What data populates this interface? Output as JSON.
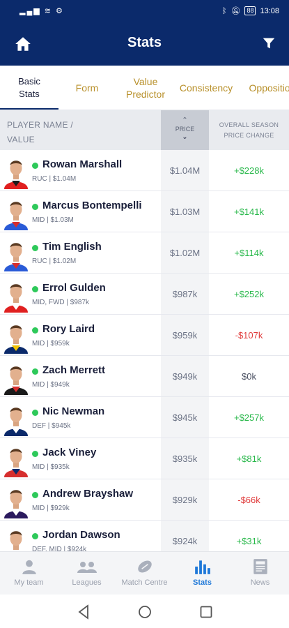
{
  "status_bar": {
    "time": "13:08",
    "battery": "88",
    "left_icons": "signal-wifi-icons"
  },
  "header": {
    "title": "Stats"
  },
  "tabs": [
    {
      "label": "Basic\nStats",
      "active": true
    },
    {
      "label": "Form"
    },
    {
      "label": "Value\nPredictor"
    },
    {
      "label": "Consistency"
    },
    {
      "label": "Opposition"
    }
  ],
  "columns": {
    "player_line1": "PLAYER NAME /",
    "player_line2": "VALUE",
    "price": "PRICE",
    "change_line1": "OVERALL SEASON",
    "change_line2": "PRICE CHANGE"
  },
  "players": [
    {
      "name": "Rowan Marshall",
      "sub": "RUC | $1.04M",
      "price": "$1.04M",
      "change": "+$228k",
      "trend": "pos",
      "jersey": "#e02020",
      "jersey2": "#1a1a1a"
    },
    {
      "name": "Marcus Bontempelli",
      "sub": "MID | $1.03M",
      "price": "$1.03M",
      "change": "+$141k",
      "trend": "pos",
      "jersey": "#2a5bd7",
      "jersey2": "#d62e2e"
    },
    {
      "name": "Tim English",
      "sub": "RUC | $1.02M",
      "price": "$1.02M",
      "change": "+$114k",
      "trend": "pos",
      "jersey": "#2a5bd7",
      "jersey2": "#d62e2e"
    },
    {
      "name": "Errol Gulden",
      "sub": "MID, FWD | $987k",
      "price": "$987k",
      "change": "+$252k",
      "trend": "pos",
      "jersey": "#e02020",
      "jersey2": "#ffffff"
    },
    {
      "name": "Rory Laird",
      "sub": "MID | $959k",
      "price": "$959k",
      "change": "-$107k",
      "trend": "neg",
      "jersey": "#0b2a6b",
      "jersey2": "#f2c200"
    },
    {
      "name": "Zach Merrett",
      "sub": "MID | $949k",
      "price": "$949k",
      "change": "$0k",
      "trend": "zero",
      "jersey": "#1a1a1a",
      "jersey2": "#d62e2e"
    },
    {
      "name": "Nic Newman",
      "sub": "DEF | $945k",
      "price": "$945k",
      "change": "+$257k",
      "trend": "pos",
      "jersey": "#0b2a6b",
      "jersey2": "#ffffff"
    },
    {
      "name": "Jack Viney",
      "sub": "MID | $935k",
      "price": "$935k",
      "change": "+$81k",
      "trend": "pos",
      "jersey": "#d62e2e",
      "jersey2": "#0b2a6b"
    },
    {
      "name": "Andrew Brayshaw",
      "sub": "MID | $929k",
      "price": "$929k",
      "change": "-$66k",
      "trend": "neg",
      "jersey": "#2b1a5e",
      "jersey2": "#ffffff"
    },
    {
      "name": "Jordan Dawson",
      "sub": "DEF, MID | $924k",
      "price": "$924k",
      "change": "+$31k",
      "trend": "pos",
      "jersey": "#0b2a6b",
      "jersey2": "#e02020"
    }
  ],
  "nav": [
    {
      "label": "My team",
      "icon": "person-icon"
    },
    {
      "label": "Leagues",
      "icon": "group-icon"
    },
    {
      "label": "Match Centre",
      "icon": "football-icon"
    },
    {
      "label": "Stats",
      "icon": "bar-chart-icon",
      "active": true
    },
    {
      "label": "News",
      "icon": "newspaper-icon"
    }
  ],
  "colors": {
    "brand": "#0b2a6b",
    "accent_gold": "#b8902a",
    "positive": "#28b84a",
    "negative": "#e03a3a",
    "active_nav": "#1e78d8"
  }
}
